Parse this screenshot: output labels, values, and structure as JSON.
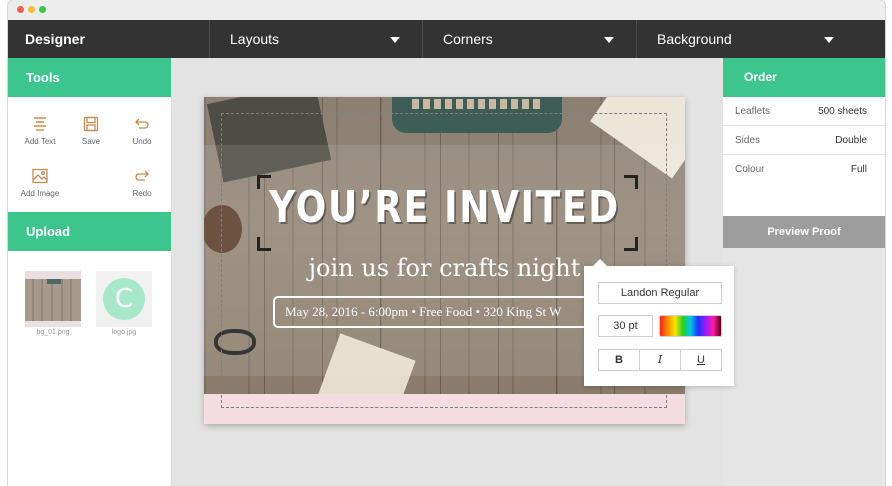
{
  "topbar": {
    "brand": "Designer",
    "menus": [
      {
        "label": "Layouts"
      },
      {
        "label": "Corners"
      },
      {
        "label": "Background"
      }
    ]
  },
  "tools": {
    "heading": "Tools",
    "items": [
      {
        "label": "Add Text",
        "icon": "text-align-icon"
      },
      {
        "label": "Save",
        "icon": "save-icon"
      },
      {
        "label": "Undo",
        "icon": "undo-icon"
      },
      {
        "label": "Add Image",
        "icon": "image-icon"
      },
      {
        "label": "Redo",
        "icon": "redo-icon"
      }
    ]
  },
  "upload": {
    "heading": "Upload",
    "files": [
      {
        "name": "bg_01.png"
      },
      {
        "name": "logo.jpg",
        "letter": "C"
      }
    ]
  },
  "card": {
    "title": "YOU’RE INVITED",
    "subtitle": "join us for crafts night",
    "details": "May 28, 2016 - 6:00pm  •  Free Food  •  320 King St W"
  },
  "text_toolbar": {
    "font": "Landon Regular",
    "size": "30 pt",
    "bold": "B",
    "italic": "I",
    "underline": "U"
  },
  "order": {
    "heading": "Order",
    "rows": [
      {
        "label": "Leaflets",
        "value": "500 sheets"
      },
      {
        "label": "Sides",
        "value": "Double"
      },
      {
        "label": "Colour",
        "value": "Full"
      }
    ],
    "preview_label": "Preview Proof"
  },
  "colors": {
    "accent": "#3cc58d",
    "topbar": "#333333",
    "card_border": "#eebec8"
  }
}
